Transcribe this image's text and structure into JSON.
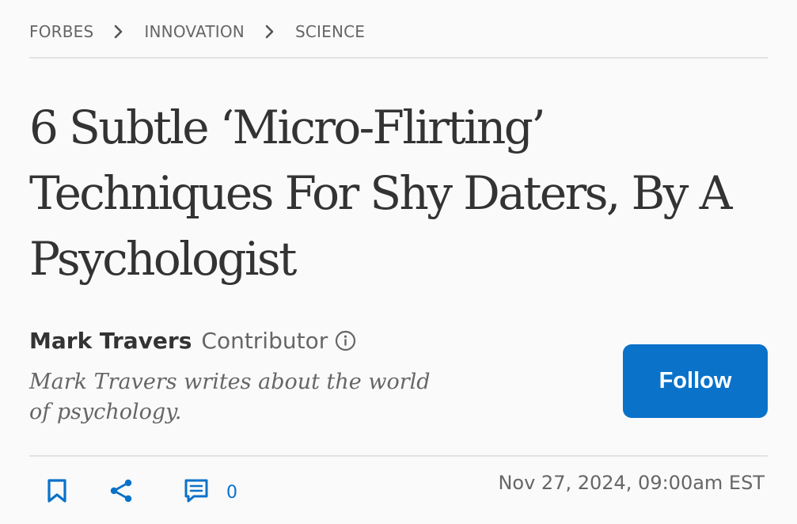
{
  "breadcrumb": {
    "items": [
      "FORBES",
      "INNOVATION",
      "SCIENCE"
    ]
  },
  "article": {
    "headline": "6 Subtle ‘Micro-Flirting’ Techniques For Shy Daters, By A Psychologist",
    "author": {
      "name": "Mark Travers",
      "role": "Contributor",
      "bio": "Mark Travers writes about the world of psychology."
    },
    "follow_label": "Follow",
    "published": "Nov 27, 2024, 09:00am EST"
  },
  "actions": {
    "comment_count": "0"
  },
  "icons": {
    "chevron": "chevron-right-icon",
    "info": "info-circle-icon",
    "bookmark": "bookmark-icon",
    "share": "share-icon",
    "comment": "comment-icon"
  },
  "colors": {
    "accent": "#0a72c9",
    "text": "#333333",
    "muted": "#666666",
    "background": "#fafafa",
    "divider": "#e3e3e3"
  }
}
